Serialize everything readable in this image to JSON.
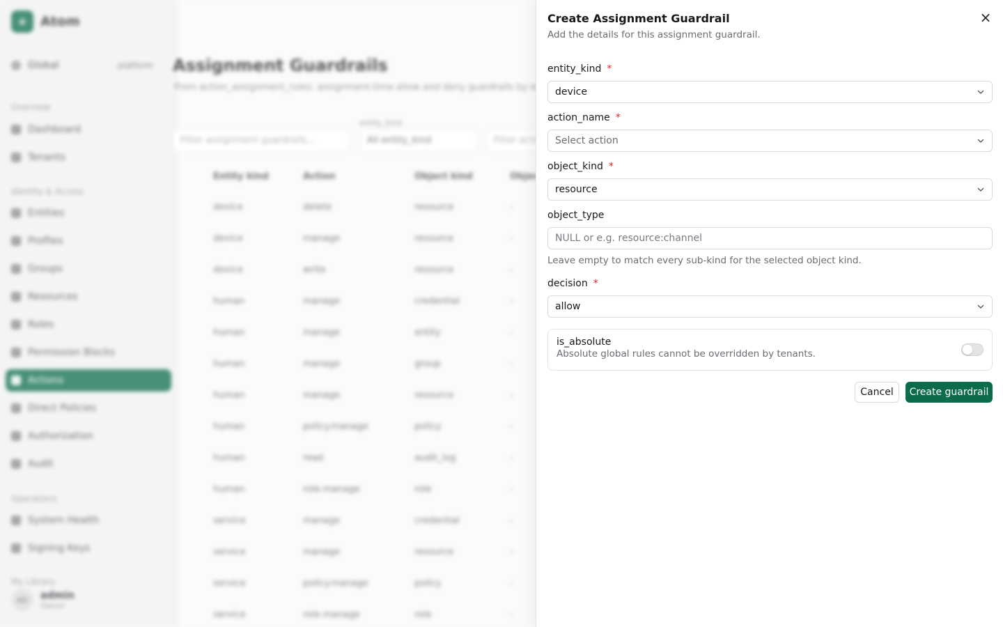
{
  "background": {
    "brand": {
      "logo": "+",
      "name": "Atom"
    },
    "scope": {
      "label": "Global",
      "tag": "platform"
    },
    "nav_groups": [
      "Overview",
      "Identity & Access",
      "Operations",
      "My Library"
    ],
    "nav_items": [
      "Dashboard",
      "Tenants",
      "Entities",
      "Profiles",
      "Groups",
      "Resources",
      "Roles",
      "Permission Blocks",
      "Actions",
      "Direct Policies",
      "Authorization",
      "Audit",
      "System Health",
      "Signing Keys"
    ],
    "active_nav": "Actions",
    "user": {
      "initials": "AD",
      "name": "admin",
      "role": "Owner"
    },
    "page_title": "Assignment Guardrails",
    "page_subtitle": "From action_assignment_rules: assignment-time allow and deny guardrails by entity",
    "filter_placeholder": "Filter assignment guardrails...",
    "entity_kind_filter_label": "entity_kind",
    "entity_kind_filter_value": "All entity_kind",
    "action_filter_placeholder": "Filter action",
    "columns": [
      "Entity kind",
      "Action",
      "Object kind",
      "Object type"
    ],
    "rows": [
      [
        "device",
        "delete",
        "resource",
        "-"
      ],
      [
        "device",
        "manage",
        "resource",
        "-"
      ],
      [
        "device",
        "write",
        "resource",
        "-"
      ],
      [
        "human",
        "manage",
        "credential",
        "-"
      ],
      [
        "human",
        "manage",
        "entity",
        "-"
      ],
      [
        "human",
        "manage",
        "group",
        "-"
      ],
      [
        "human",
        "manage",
        "resource",
        "-"
      ],
      [
        "human",
        "policy.manage",
        "policy",
        "-"
      ],
      [
        "human",
        "read",
        "audit_log",
        "-"
      ],
      [
        "human",
        "role.manage",
        "role",
        "-"
      ],
      [
        "service",
        "manage",
        "credential",
        "-"
      ],
      [
        "service",
        "manage",
        "resource",
        "-"
      ],
      [
        "service",
        "policy.manage",
        "policy",
        "-"
      ],
      [
        "service",
        "role.manage",
        "role",
        "-"
      ]
    ]
  },
  "drawer": {
    "title": "Create Assignment Guardrail",
    "subtitle": "Add the details for this assignment guardrail.",
    "close_icon": "×",
    "fields": {
      "entity_kind": {
        "label": "entity_kind",
        "required": "*",
        "value": "device"
      },
      "action_name": {
        "label": "action_name",
        "required": "*",
        "placeholder": "Select action"
      },
      "object_kind": {
        "label": "object_kind",
        "required": "*",
        "value": "resource"
      },
      "object_type": {
        "label": "object_type",
        "placeholder": "NULL or e.g. resource:channel",
        "value": "",
        "help": "Leave empty to match every sub-kind for the selected object kind."
      },
      "decision": {
        "label": "decision",
        "required": "*",
        "value": "allow"
      }
    },
    "is_absolute": {
      "title": "is_absolute",
      "description": "Absolute global rules cannot be overridden by tenants.",
      "checked": false
    },
    "buttons": {
      "cancel": "Cancel",
      "create": "Create guardrail"
    },
    "accent_color": "#0b6b4c",
    "required_color": "#dc2626"
  }
}
